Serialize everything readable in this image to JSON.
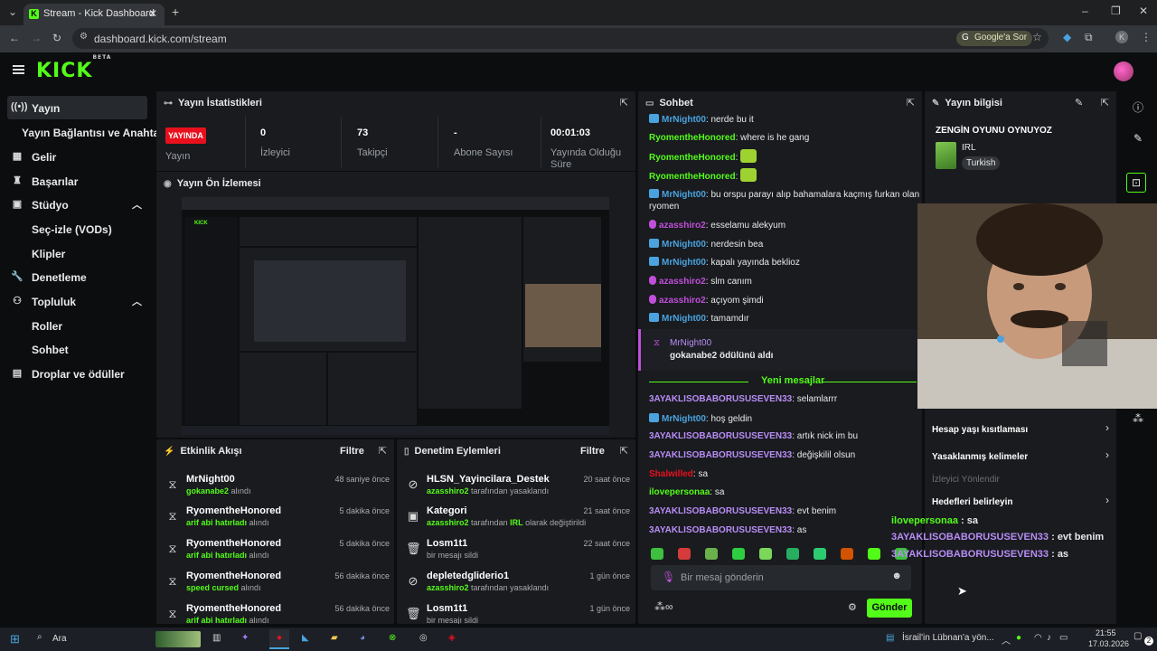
{
  "browser": {
    "tab_title": "Stream - Kick Dashboard",
    "url": "dashboard.kick.com/stream",
    "google_chip": "Google'a Sor",
    "profile_initial": "K"
  },
  "brand": {
    "logo": "KICK",
    "logo_tag": "BETA",
    "accent": "#53fc18"
  },
  "sidebar": {
    "items": [
      {
        "label": "Yayın",
        "icon": "broadcast-icon"
      },
      {
        "label": "Yayın Bağlantısı ve Anahtarı"
      },
      {
        "label": "Gelir",
        "icon": "revenue-icon"
      },
      {
        "label": "Başarılar",
        "icon": "trophy-icon"
      },
      {
        "label": "Stüdyo",
        "icon": "studio-icon"
      },
      {
        "label": "Seç-izle (VODs)"
      },
      {
        "label": "Klipler"
      },
      {
        "label": "Denetleme",
        "icon": "wrench-icon"
      },
      {
        "label": "Topluluk",
        "icon": "community-icon"
      },
      {
        "label": "Roller"
      },
      {
        "label": "Sohbet"
      },
      {
        "label": "Droplar ve ödüller",
        "icon": "drops-icon"
      }
    ]
  },
  "stats": {
    "title": "Yayın İstatistikleri",
    "live_badge": "YAYINDA",
    "items": [
      {
        "value": "",
        "label": "Yayın"
      },
      {
        "value": "0",
        "label": "İzleyici"
      },
      {
        "value": "73",
        "label": "Takipçi"
      },
      {
        "value": "-",
        "label": "Abone Sayısı"
      },
      {
        "value": "00:01:03",
        "label": "Yayında Olduğu Süre"
      }
    ]
  },
  "preview": {
    "title": "Yayın Ön İzlemesi"
  },
  "activity": {
    "title": "Etkinlik Akışı",
    "filter": "Filtre",
    "items": [
      {
        "name": "MrNight00",
        "reward": "gokanabe2",
        "action": "alındı",
        "time": "48 saniye önce"
      },
      {
        "name": "RyomentheHonored",
        "reward": "arif abi hatırladı",
        "action": "alındı",
        "time": "5 dakika önce"
      },
      {
        "name": "RyomentheHonored",
        "reward": "arif abi hatırladı",
        "action": "alındı",
        "time": "5 dakika önce"
      },
      {
        "name": "RyomentheHonored",
        "reward": "speed cursed",
        "action": "alındı",
        "time": "56 dakika önce"
      },
      {
        "name": "RyomentheHonored",
        "reward": "arif abi hatırladı",
        "action": "alındı",
        "time": "56 dakika önce"
      }
    ]
  },
  "moderation": {
    "title": "Denetim Eylemleri",
    "filter": "Filtre",
    "items": [
      {
        "name": "HLSN_Yayincilara_Destek",
        "actor": "azasshiro2",
        "action": "tarafından yasaklandı",
        "time": "20 saat önce",
        "icon": "ban-icon"
      },
      {
        "name": "Kategori",
        "actor": "azasshiro2",
        "action": "tarafından",
        "extra": "IRL",
        "tail": "olarak değiştirildi",
        "time": "21 saat önce",
        "icon": "category-icon"
      },
      {
        "name": "Losm1t1",
        "actor": "",
        "action": "bir mesajı sildi",
        "time": "22 saat önce",
        "icon": "trash-icon"
      },
      {
        "name": "depletedgliderio1",
        "actor": "azasshiro2",
        "action": "tarafından yasaklandı",
        "time": "1 gün önce",
        "icon": "ban-icon"
      },
      {
        "name": "Losm1t1",
        "actor": "",
        "action": "bir mesajı sildi",
        "time": "1 gün önce",
        "icon": "trash-icon"
      }
    ]
  },
  "chat": {
    "title": "Sohbet",
    "messages": [
      {
        "user": "MrNight00",
        "color": "#4aa3df",
        "badge": "bot",
        "text": "nerde bu it"
      },
      {
        "user": "RyomentheHonored",
        "color": "#53fc18",
        "badge": "",
        "text": "where is he gang"
      },
      {
        "user": "RyomentheHonored",
        "color": "#53fc18",
        "badge": "",
        "text": "",
        "emote": true
      },
      {
        "user": "RyomentheHonored",
        "color": "#53fc18",
        "badge": "",
        "text": "",
        "emote": true
      },
      {
        "user": "MrNight00",
        "color": "#4aa3df",
        "badge": "bot",
        "text": "bu orspu parayı alıp bahamalara kaçmış furkan olan"
      },
      {
        "user": "",
        "color": "",
        "badge": "",
        "text": "ryomen"
      },
      {
        "user": "azasshiro2",
        "color": "#c04fd9",
        "badge": "mic",
        "text": "esselamu alekyum"
      },
      {
        "user": "MrNight00",
        "color": "#4aa3df",
        "badge": "bot",
        "text": "nerdesin bea"
      },
      {
        "user": "MrNight00",
        "color": "#4aa3df",
        "badge": "bot",
        "text": "kapalı yayında beklioz"
      },
      {
        "user": "azasshiro2",
        "color": "#c04fd9",
        "badge": "mic",
        "text": "slm canım"
      },
      {
        "user": "azasshiro2",
        "color": "#c04fd9",
        "badge": "mic",
        "text": "açıyom şimdi"
      },
      {
        "user": "MrNight00",
        "color": "#4aa3df",
        "badge": "bot",
        "text": "tamamdır"
      }
    ],
    "reward_notice": {
      "user": "MrNight00",
      "text": "gokanabe2 ödülünü aldı"
    },
    "new_messages_label": "Yeni mesajlar",
    "new_messages": [
      {
        "user": "3AYAKLISOBABORUSUSEVEN33",
        "color": "#b88df5",
        "badge": "",
        "text": "selamlarrr"
      },
      {
        "user": "MrNight00",
        "color": "#4aa3df",
        "badge": "bot",
        "text": "hoş geldin"
      },
      {
        "user": "3AYAKLISOBABORUSUSEVEN33",
        "color": "#b88df5",
        "badge": "",
        "text": "artık nick im bu"
      },
      {
        "user": "3AYAKLISOBABORUSUSEVEN33",
        "color": "#b88df5",
        "badge": "",
        "text": "değişkilil olsun"
      },
      {
        "user": "Shalwilled",
        "color": "#e9101d",
        "badge": "",
        "text": "sa"
      },
      {
        "user": "ilovepersonaa",
        "color": "#53fc18",
        "badge": "",
        "text": "sa"
      },
      {
        "user": "3AYAKLISOBABORUSUSEVEN33",
        "color": "#b88df5",
        "badge": "",
        "text": "evt benim"
      },
      {
        "user": "3AYAKLISOBABORUSUSEVEN33",
        "color": "#b88df5",
        "badge": "",
        "text": "as"
      }
    ],
    "input_placeholder": "Bir mesaj gönderin",
    "send_label": "Gönder"
  },
  "stream_info": {
    "title": "Yayın bilgisi",
    "stream_title": "ZENGİN OYUNU OYNUYOZ",
    "category": "IRL",
    "language": "Turkish",
    "settings": [
      {
        "label": "Hesap yaşı kısıtlaması",
        "enabled": true
      },
      {
        "label": "Yasaklanmış kelimeler",
        "enabled": true
      },
      {
        "label": "İzleyici Yönlendir",
        "enabled": false
      },
      {
        "label": "Hedefleri belirleyin",
        "enabled": true
      }
    ]
  },
  "overlay_chat": [
    {
      "user": "ilovepersonaa",
      "color": "#53fc18",
      "text": "sa"
    },
    {
      "user": "3AYAKLISOBABORUSUSEVEN33",
      "color": "#b88df5",
      "text": "evt benim"
    },
    {
      "user": "3AYAKLISOBABORUSUSEVEN33",
      "color": "#b88df5",
      "text": "as"
    }
  ],
  "taskbar": {
    "search": "Ara",
    "news": "İsrail'in Lübnan'a yön...",
    "time": "21:55",
    "date": "17.03.2026",
    "notif_count": "2"
  }
}
